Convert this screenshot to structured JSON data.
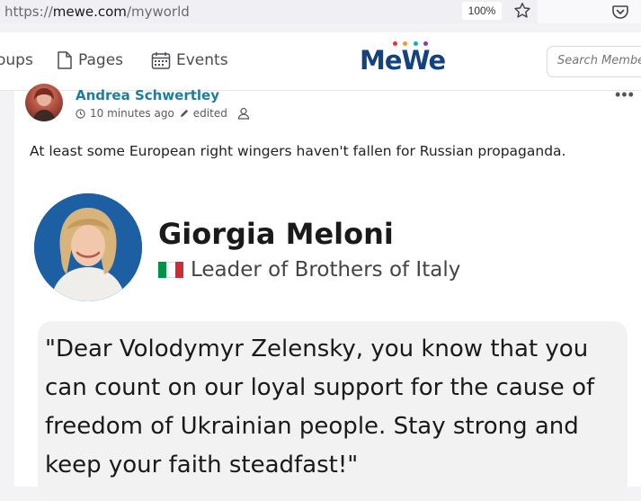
{
  "browser": {
    "url_scheme": "https://",
    "url_host": "mewe.com",
    "url_path": "/myworld",
    "zoom": "100%"
  },
  "nav": {
    "items": [
      {
        "label": "oups",
        "icon": "groups-icon"
      },
      {
        "label": "Pages",
        "icon": "page-icon"
      },
      {
        "label": "Events",
        "icon": "calendar-icon"
      }
    ],
    "logo": "MeWe",
    "logo_colors": [
      "#e8312f",
      "#f29a2e",
      "#1aa9c8",
      "#8a3c9f"
    ],
    "search_placeholder": "Search Membe"
  },
  "post": {
    "author": "Andrea Schwertley",
    "time": "10 minutes ago",
    "edited": "edited",
    "text": "At least some European right wingers haven't fallen for Russian propaganda.",
    "embed": {
      "name": "Giorgia Meloni",
      "role": "Leader of Brothers of Italy",
      "flag_colors": [
        "#009246",
        "#ffffff",
        "#ce2b37"
      ],
      "quote": "\"Dear Volodymyr Zelensky, you know that you can count on our loyal support for the cause of freedom of Ukrainian people. Stay strong and keep your faith steadfast!\""
    }
  }
}
